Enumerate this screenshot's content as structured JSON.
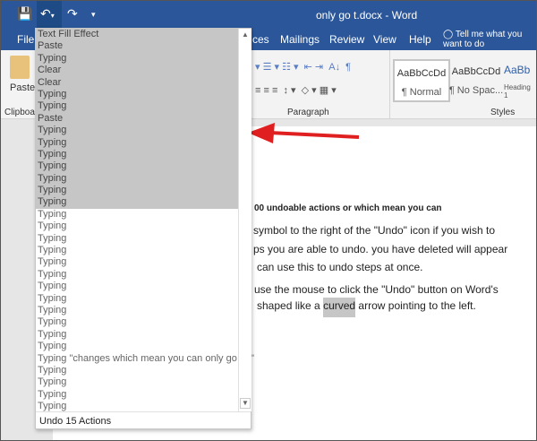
{
  "window_title": "only go t.docx  -  Word",
  "quick_access": {
    "save_icon": "save-icon",
    "undo_icon": "undo-icon",
    "redo_icon": "redo-icon",
    "customize_icon": "customize-icon"
  },
  "tabs": {
    "file": "File",
    "references_partial": "ces",
    "mailings": "Mailings",
    "review": "Review",
    "view": "View",
    "help": "Help",
    "tell_me": "Tell me what you want to do"
  },
  "ribbon": {
    "paste": "Paste",
    "clipboard": "Clipboard",
    "paragraph": "Paragraph",
    "styles": "Styles",
    "style_items": [
      {
        "preview": "AaBbCcDd",
        "name": "¶ Normal"
      },
      {
        "preview": "AaBbCcDd",
        "name": "¶ No Spac..."
      },
      {
        "preview": "AaBb",
        "name": "Heading 1"
      }
    ]
  },
  "undo_list": {
    "selected": [
      "Text Fill Effect",
      "Paste",
      "Typing",
      "Clear",
      "Clear",
      "Typing",
      "Typing",
      "Paste",
      "Typing",
      "Typing",
      "Typing",
      "Typing",
      "Typing",
      "Typing",
      "Typing"
    ],
    "unselected": [
      "Typing",
      "Typing",
      "Typing",
      "Typing",
      "Typing",
      "Typing",
      "Typing",
      "Typing",
      "Typing",
      "Typing",
      "Typing",
      "Typing",
      "Typing \"changes which mean you can only go to \"",
      "Typing",
      "Typing",
      "Typing",
      "Typing"
    ],
    "footer": "Undo 15 Actions"
  },
  "document": {
    "heading": "00 undoable actions or which mean you can",
    "line1": "symbol to the right of the \"Undo\" icon if you wish to",
    "line2": "ps you are able to undo. you have deleted will appear",
    "line3": "can use this to undo steps at once.",
    "line4": "use the mouse to click the \"Undo\" button on Word's",
    "line5_pre": "shaped like a ",
    "line5_hl": "curved",
    "line5_post": " arrow pointing to the left."
  },
  "colors": {
    "title_bar": "#2b579a",
    "selection": "#c6c6c6",
    "arrow": "#e02020"
  }
}
